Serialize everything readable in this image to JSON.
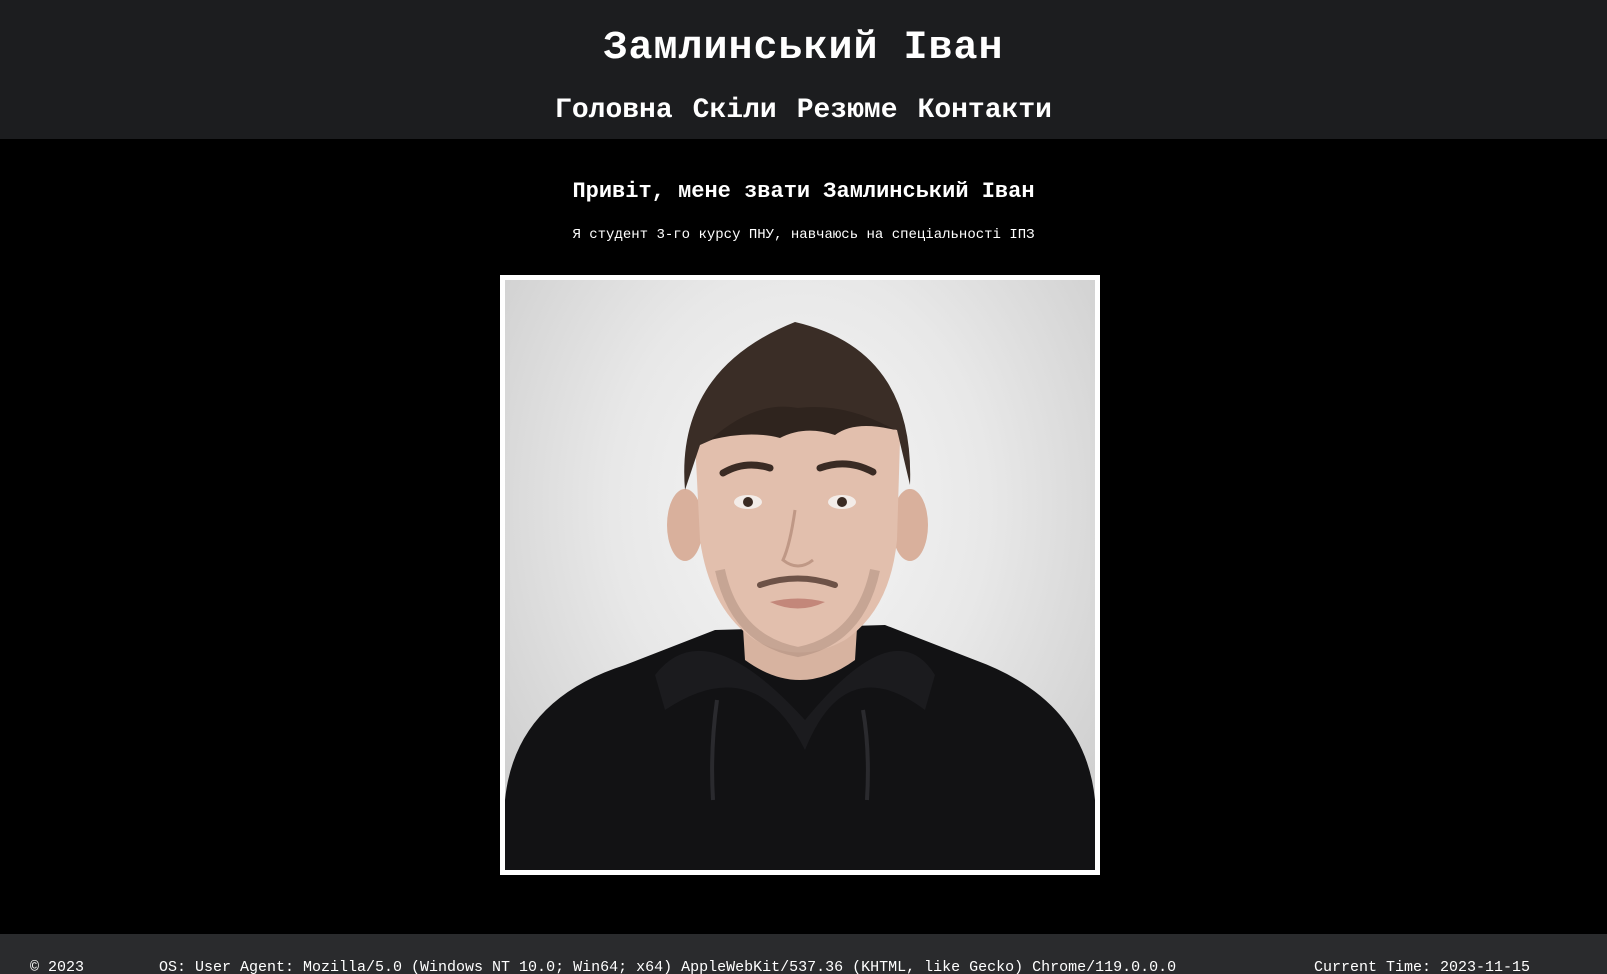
{
  "header": {
    "title": "Замлинський Іван",
    "nav": [
      {
        "label": "Головна"
      },
      {
        "label": "Скіли"
      },
      {
        "label": "Резюме"
      },
      {
        "label": "Контакти"
      }
    ]
  },
  "main": {
    "greeting": "Привіт, мене звати Замлинський Іван",
    "intro": "Я студент 3-го курсу ПНУ, навчаюсь на спеціальності ІПЗ"
  },
  "footer": {
    "copyright": "© 2023",
    "os": "OS:  User Agent: Mozilla/5.0 (Windows NT 10.0; Win64; x64) AppleWebKit/537.36 (KHTML, like Gecko) Chrome/119.0.0.0",
    "time": "Current Time: 2023-11-15"
  },
  "colors": {
    "header_bg": "#1c1d1f",
    "page_bg": "#000000",
    "footer_bg": "#2a2b2d",
    "text": "#ffffff"
  }
}
